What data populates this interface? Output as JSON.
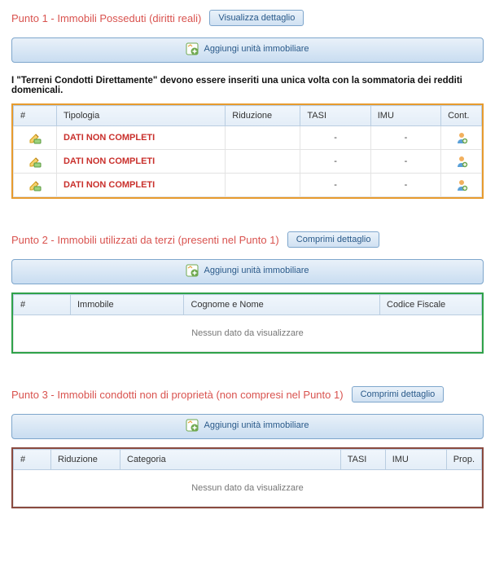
{
  "buttons": {
    "visualize": "Visualizza dettaglio",
    "collapse": "Comprimi dettaglio"
  },
  "add_label": "Aggiungi unità immobiliare",
  "note_p1": "I \"Terreni Condotti Direttamente\" devono essere inseriti una unica volta con la sommatoria dei redditi domenicali.",
  "empty": "Nessun dato da visualizzare",
  "section1": {
    "title": "Punto 1 - Immobili Posseduti (diritti reali)",
    "headers": {
      "num": "#",
      "tipologia": "Tipologia",
      "riduzione": "Riduzione",
      "tasi": "TASI",
      "imu": "IMU",
      "cont": "Cont."
    },
    "rows": [
      {
        "tipologia": "DATI NON COMPLETI",
        "riduzione": "",
        "tasi": "-",
        "imu": "-"
      },
      {
        "tipologia": "DATI NON COMPLETI",
        "riduzione": "",
        "tasi": "-",
        "imu": "-"
      },
      {
        "tipologia": "DATI NON COMPLETI",
        "riduzione": "",
        "tasi": "-",
        "imu": "-"
      }
    ]
  },
  "section2": {
    "title": "Punto 2 - Immobili utilizzati da terzi (presenti nel Punto 1)",
    "headers": {
      "num": "#",
      "immobile": "Immobile",
      "cognome": "Cognome e Nome",
      "cf": "Codice Fiscale"
    }
  },
  "section3": {
    "title": "Punto 3 - Immobili condotti non di proprietà (non compresi nel Punto 1)",
    "headers": {
      "num": "#",
      "riduzione": "Riduzione",
      "categoria": "Categoria",
      "tasi": "TASI",
      "imu": "IMU",
      "prop": "Prop."
    }
  }
}
